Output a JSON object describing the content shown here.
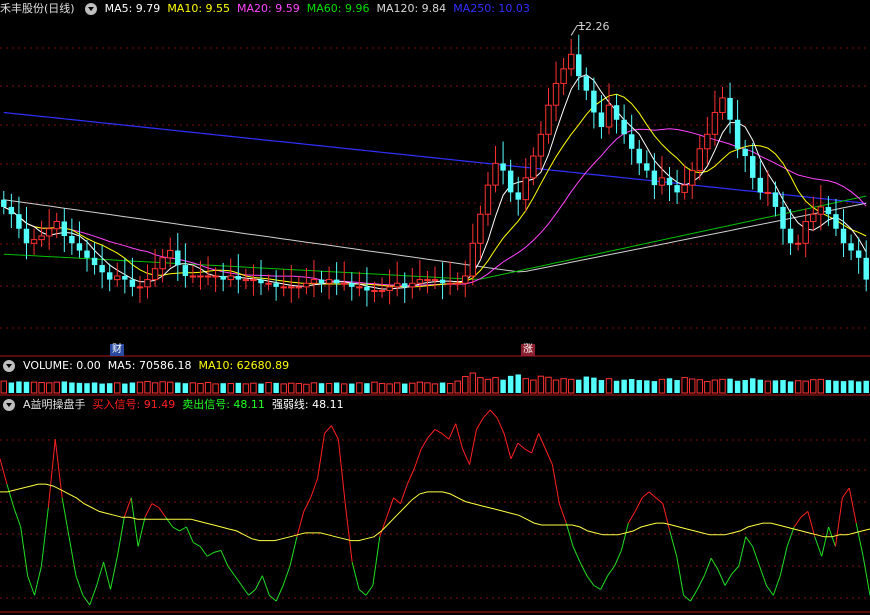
{
  "header": {
    "stock_title": "禾丰股份(日线)",
    "ma_labels": [
      {
        "text": "MA5: 9.79",
        "color": "#ffffff"
      },
      {
        "text": "MA10: 9.55",
        "color": "#ffff00"
      },
      {
        "text": "MA20: 9.59",
        "color": "#ff44ff"
      },
      {
        "text": "MA60: 9.96",
        "color": "#00e000"
      },
      {
        "text": "MA120: 9.84",
        "color": "#d8d8d8"
      },
      {
        "text": "MA250: 10.03",
        "color": "#3030ff"
      }
    ]
  },
  "volume_panel": {
    "labels": [
      {
        "text": "VOLUME: 0.00",
        "color": "#ffffff"
      },
      {
        "text": "MA5: 70586.18",
        "color": "#ffffff"
      },
      {
        "text": "MA10: 62680.89",
        "color": "#ffff00"
      }
    ]
  },
  "indicator_panel": {
    "name": "A益明操盘手",
    "labels": [
      {
        "text": "买入信号: 91.49",
        "color": "#ff2020"
      },
      {
        "text": "卖出信号: 48.11",
        "color": "#20ff20"
      },
      {
        "text": "强弱线: 48.11",
        "color": "#ffffff"
      }
    ]
  },
  "annotations": {
    "peak_label": "12.26",
    "marker_cai": "财",
    "marker_zhang": "涨"
  },
  "chart_data": {
    "type": "candlestick",
    "main": {
      "ylim": [
        8.0,
        12.5
      ],
      "peak": 12.26,
      "closes": [
        9.9,
        9.8,
        9.6,
        9.4,
        9.45,
        9.5,
        9.6,
        9.7,
        9.5,
        9.4,
        9.3,
        9.2,
        9.1,
        9.0,
        8.9,
        8.95,
        8.9,
        8.8,
        8.8,
        8.9,
        9.05,
        9.2,
        9.3,
        9.1,
        8.95,
        8.95,
        8.95,
        8.95,
        8.95,
        8.9,
        8.95,
        8.9,
        8.9,
        8.9,
        8.85,
        8.85,
        8.8,
        8.8,
        8.8,
        8.8,
        8.85,
        8.9,
        8.85,
        8.9,
        8.85,
        8.85,
        8.8,
        8.8,
        8.75,
        8.75,
        8.75,
        8.8,
        8.85,
        8.8,
        8.85,
        8.9,
        8.9,
        8.9,
        8.85,
        8.85,
        8.85,
        8.95,
        9.4,
        9.8,
        10.2,
        10.5,
        10.4,
        10.1,
        10.0,
        10.3,
        10.6,
        10.9,
        11.3,
        11.6,
        11.8,
        12.0,
        11.7,
        11.5,
        11.2,
        11.0,
        11.3,
        11.1,
        10.9,
        10.7,
        10.5,
        10.4,
        10.2,
        10.3,
        10.2,
        10.1,
        10.2,
        10.4,
        10.7,
        10.9,
        11.2,
        11.4,
        11.1,
        10.7,
        10.6,
        10.3,
        10.1,
        10.1,
        9.9,
        9.6,
        9.4,
        9.4,
        9.7,
        9.8,
        9.9,
        9.8,
        9.6,
        9.4,
        9.3,
        9.2,
        8.9
      ]
    },
    "volume": {
      "values": [
        34,
        30,
        33,
        32,
        31,
        30,
        29,
        31,
        33,
        30,
        29,
        28,
        30,
        27,
        28,
        29,
        27,
        30,
        31,
        33,
        29,
        32,
        31,
        30,
        28,
        29,
        27,
        30,
        26,
        28,
        27,
        29,
        26,
        28,
        27,
        30,
        29,
        26,
        28,
        27,
        25,
        29,
        28,
        27,
        30,
        26,
        27,
        29,
        28,
        31,
        27,
        26,
        29,
        27,
        28,
        31,
        29,
        26,
        30,
        27,
        34,
        47,
        57,
        44,
        39,
        44,
        38,
        49,
        53,
        41,
        37,
        48,
        45,
        37,
        41,
        39,
        38,
        47,
        44,
        37,
        41,
        35,
        38,
        40,
        37,
        36,
        34,
        39,
        42,
        37,
        44,
        40,
        38,
        33,
        37,
        39,
        41,
        35,
        37,
        42,
        38,
        34,
        36,
        37,
        33,
        35,
        34,
        38,
        39,
        37,
        35,
        34,
        36,
        33,
        35,
        37
      ]
    },
    "indicator": {
      "ylim": [
        0,
        100
      ],
      "signal": [
        75,
        62,
        50,
        40,
        15,
        5,
        20,
        50,
        85,
        55,
        35,
        15,
        5,
        0,
        10,
        22,
        8,
        25,
        45,
        55,
        30,
        45,
        52,
        50,
        45,
        40,
        38,
        40,
        32,
        30,
        25,
        27,
        28,
        20,
        15,
        10,
        5,
        8,
        15,
        5,
        2,
        10,
        20,
        35,
        48,
        55,
        65,
        88,
        92,
        85,
        52,
        22,
        8,
        5,
        10,
        35,
        45,
        55,
        52,
        62,
        70,
        80,
        86,
        90,
        88,
        85,
        93,
        80,
        72,
        90,
        96,
        100,
        96,
        88,
        75,
        83,
        80,
        78,
        88,
        80,
        72,
        52,
        42,
        30,
        22,
        15,
        10,
        8,
        15,
        20,
        28,
        42,
        48,
        55,
        58,
        55,
        52,
        38,
        25,
        5,
        2,
        8,
        15,
        24,
        18,
        10,
        16,
        20,
        35,
        30,
        20,
        10,
        5,
        15,
        30,
        40,
        45,
        48,
        35,
        25,
        40,
        30,
        55,
        60,
        42,
        25,
        5
      ],
      "strength": [
        58,
        58,
        59,
        60,
        61,
        62,
        62,
        61,
        59,
        57,
        55,
        52,
        50,
        48,
        47,
        46,
        45,
        45,
        44,
        44,
        44,
        44,
        44,
        44,
        44,
        44,
        43,
        42,
        41,
        40,
        39,
        38,
        36,
        34,
        33,
        33,
        33,
        34,
        35,
        36,
        37,
        37,
        37,
        36,
        35,
        34,
        33,
        33,
        34,
        35,
        38,
        42,
        46,
        50,
        54,
        57,
        58,
        58,
        58,
        57,
        55,
        53,
        52,
        51,
        50,
        49,
        48,
        47,
        46,
        44,
        42,
        41,
        41,
        41,
        41,
        41,
        40,
        38,
        37,
        36,
        36,
        36,
        37,
        38,
        40,
        41,
        42,
        42,
        41,
        40,
        39,
        38,
        37,
        36,
        36,
        36,
        37,
        38,
        40,
        41,
        42,
        42,
        41,
        40,
        39,
        38,
        37,
        36,
        35,
        35,
        36,
        36,
        37,
        38,
        39
      ]
    }
  }
}
